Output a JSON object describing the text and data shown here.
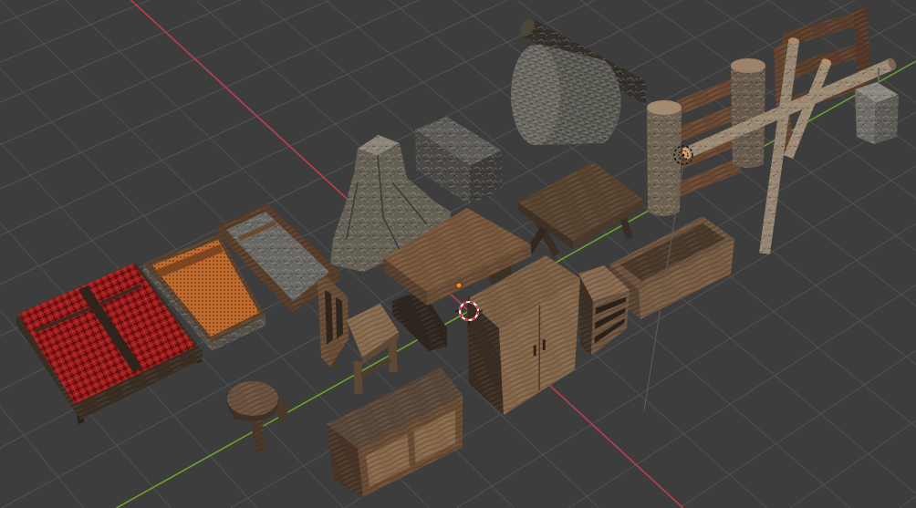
{
  "viewport": {
    "objects": [
      {
        "kind": "log"
      },
      {
        "kind": "bale"
      },
      {
        "kind": "block"
      },
      {
        "kind": "hearth"
      },
      {
        "kind": "trestle"
      },
      {
        "kind": "fence",
        "parts": [
          {
            "kind": "gate"
          },
          {
            "kind": "panel"
          },
          {
            "kind": "poles"
          },
          {
            "kind": "bucket"
          }
        ]
      },
      {
        "kind": "pallet"
      },
      {
        "kind": "cot"
      },
      {
        "kind": "bed"
      },
      {
        "kind": "trough"
      },
      {
        "kind": "table"
      },
      {
        "kind": "nightstand"
      },
      {
        "kind": "wardrobe"
      },
      {
        "kind": "chair"
      },
      {
        "kind": "stool"
      },
      {
        "kind": "sideboard"
      }
    ],
    "markers": [
      {
        "kind": "light"
      },
      {
        "kind": "origin"
      },
      {
        "kind": "cursor"
      }
    ]
  }
}
